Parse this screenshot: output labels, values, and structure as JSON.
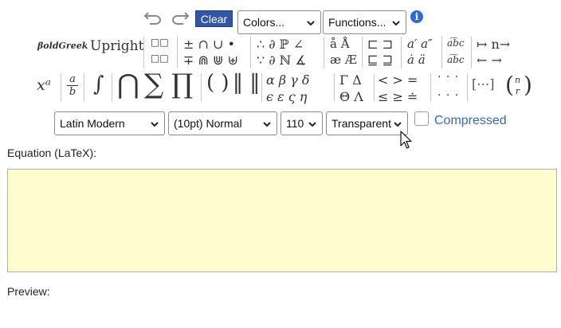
{
  "toolbar": {
    "undo_icon": "undo-icon",
    "redo_icon": "redo-icon",
    "clear_label": "Clear",
    "colors_select": "Colors...",
    "functions_select": "Functions...",
    "info_icon": "info-icon",
    "info_glyph": "i"
  },
  "palette": {
    "row1": {
      "boldgreek": "βoldGreek",
      "upright": "Upright",
      "boxes_a": "□□",
      "boxes_b": "□□",
      "ops_a": "± ∩ ∪ •",
      "ops_b": "∓ ⋒ ⋓ ⊎",
      "logic_a": "∴ ∂ ℙ ∠",
      "logic_b": "∵ ∂ ℕ ∡",
      "accent_a": "å Å",
      "accent_b": "æ Æ",
      "subset_a": "⊏ ⊐",
      "subset_b": "⊑ ⊒",
      "prime_a": "a′ a″",
      "prime_b": "ȧ ä",
      "abc_a": "a͡bc",
      "abc_b": "a͡bc",
      "arrows_a": "↦ n→",
      "arrows_b": "← →"
    },
    "row2": {
      "superscript": "xᵃ",
      "frac_num": "a",
      "frac_den": "b",
      "integral": "∫",
      "bigcap": "⋂",
      "sum": "∑",
      "prod": "∏",
      "parens": "( )",
      "norms": "‖ ‖",
      "greek_a": "α β γ δ",
      "greek_b": "ϵ ε ς η",
      "caps_a": "Γ Δ",
      "caps_b": "Θ Λ",
      "rel_a": "< > =",
      "rel_b": "≤ ≥ ≐",
      "dots_a": "· · ·",
      "dots_b": "· · ·",
      "matrix": "[⋯]",
      "binom_n": "n",
      "binom_r": "r"
    }
  },
  "options": {
    "font_select": "Latin Modern",
    "size_select": "(10pt) Normal",
    "dpi_select": "110",
    "background_select": "Transparent",
    "compressed_label": "Compressed",
    "compressed_checked": false
  },
  "equation": {
    "label": "Equation (LaTeX):",
    "value": ""
  },
  "preview": {
    "label": "Preview:"
  },
  "colors": {
    "clear_bg": "#2f56a8",
    "equation_bg": "#fffdd0",
    "compressed_text": "#3a67b3",
    "info_bg": "#2a6bd4"
  }
}
